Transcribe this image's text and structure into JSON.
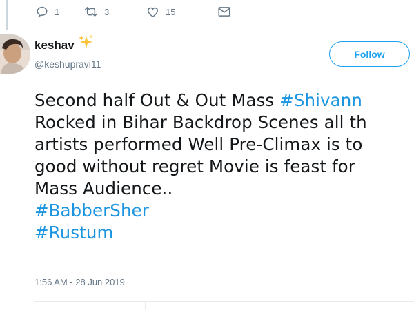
{
  "actions": {
    "reply": {
      "icon": "reply-icon",
      "count": "1"
    },
    "retweet": {
      "icon": "retweet-icon",
      "count": "3"
    },
    "like": {
      "icon": "heart-icon",
      "count": "15"
    },
    "message": {
      "icon": "envelope-icon"
    }
  },
  "user": {
    "name": "keshav",
    "emoji": "sparkles-icon",
    "handle": "@keshupravi11"
  },
  "follow": {
    "label": "Follow"
  },
  "tweet": {
    "line1_text": "Second half Out & Out Mass ",
    "line1_tag": "#Shivann",
    "line2": "Rocked in Bihar Backdrop Scenes all th",
    "line3": "artists performed Well Pre-Climax is to",
    "line4": "good without regret Movie is feast for",
    "line5": "Mass Audience..",
    "tag1": "#BabberSher",
    "tag2": "#Rustum",
    "timestamp": "1:56 AM - 28 Jun 2019"
  },
  "colors": {
    "accent": "#1da1f2",
    "hashtag": "#1b95e0",
    "muted": "#657786",
    "text": "#14171a"
  }
}
